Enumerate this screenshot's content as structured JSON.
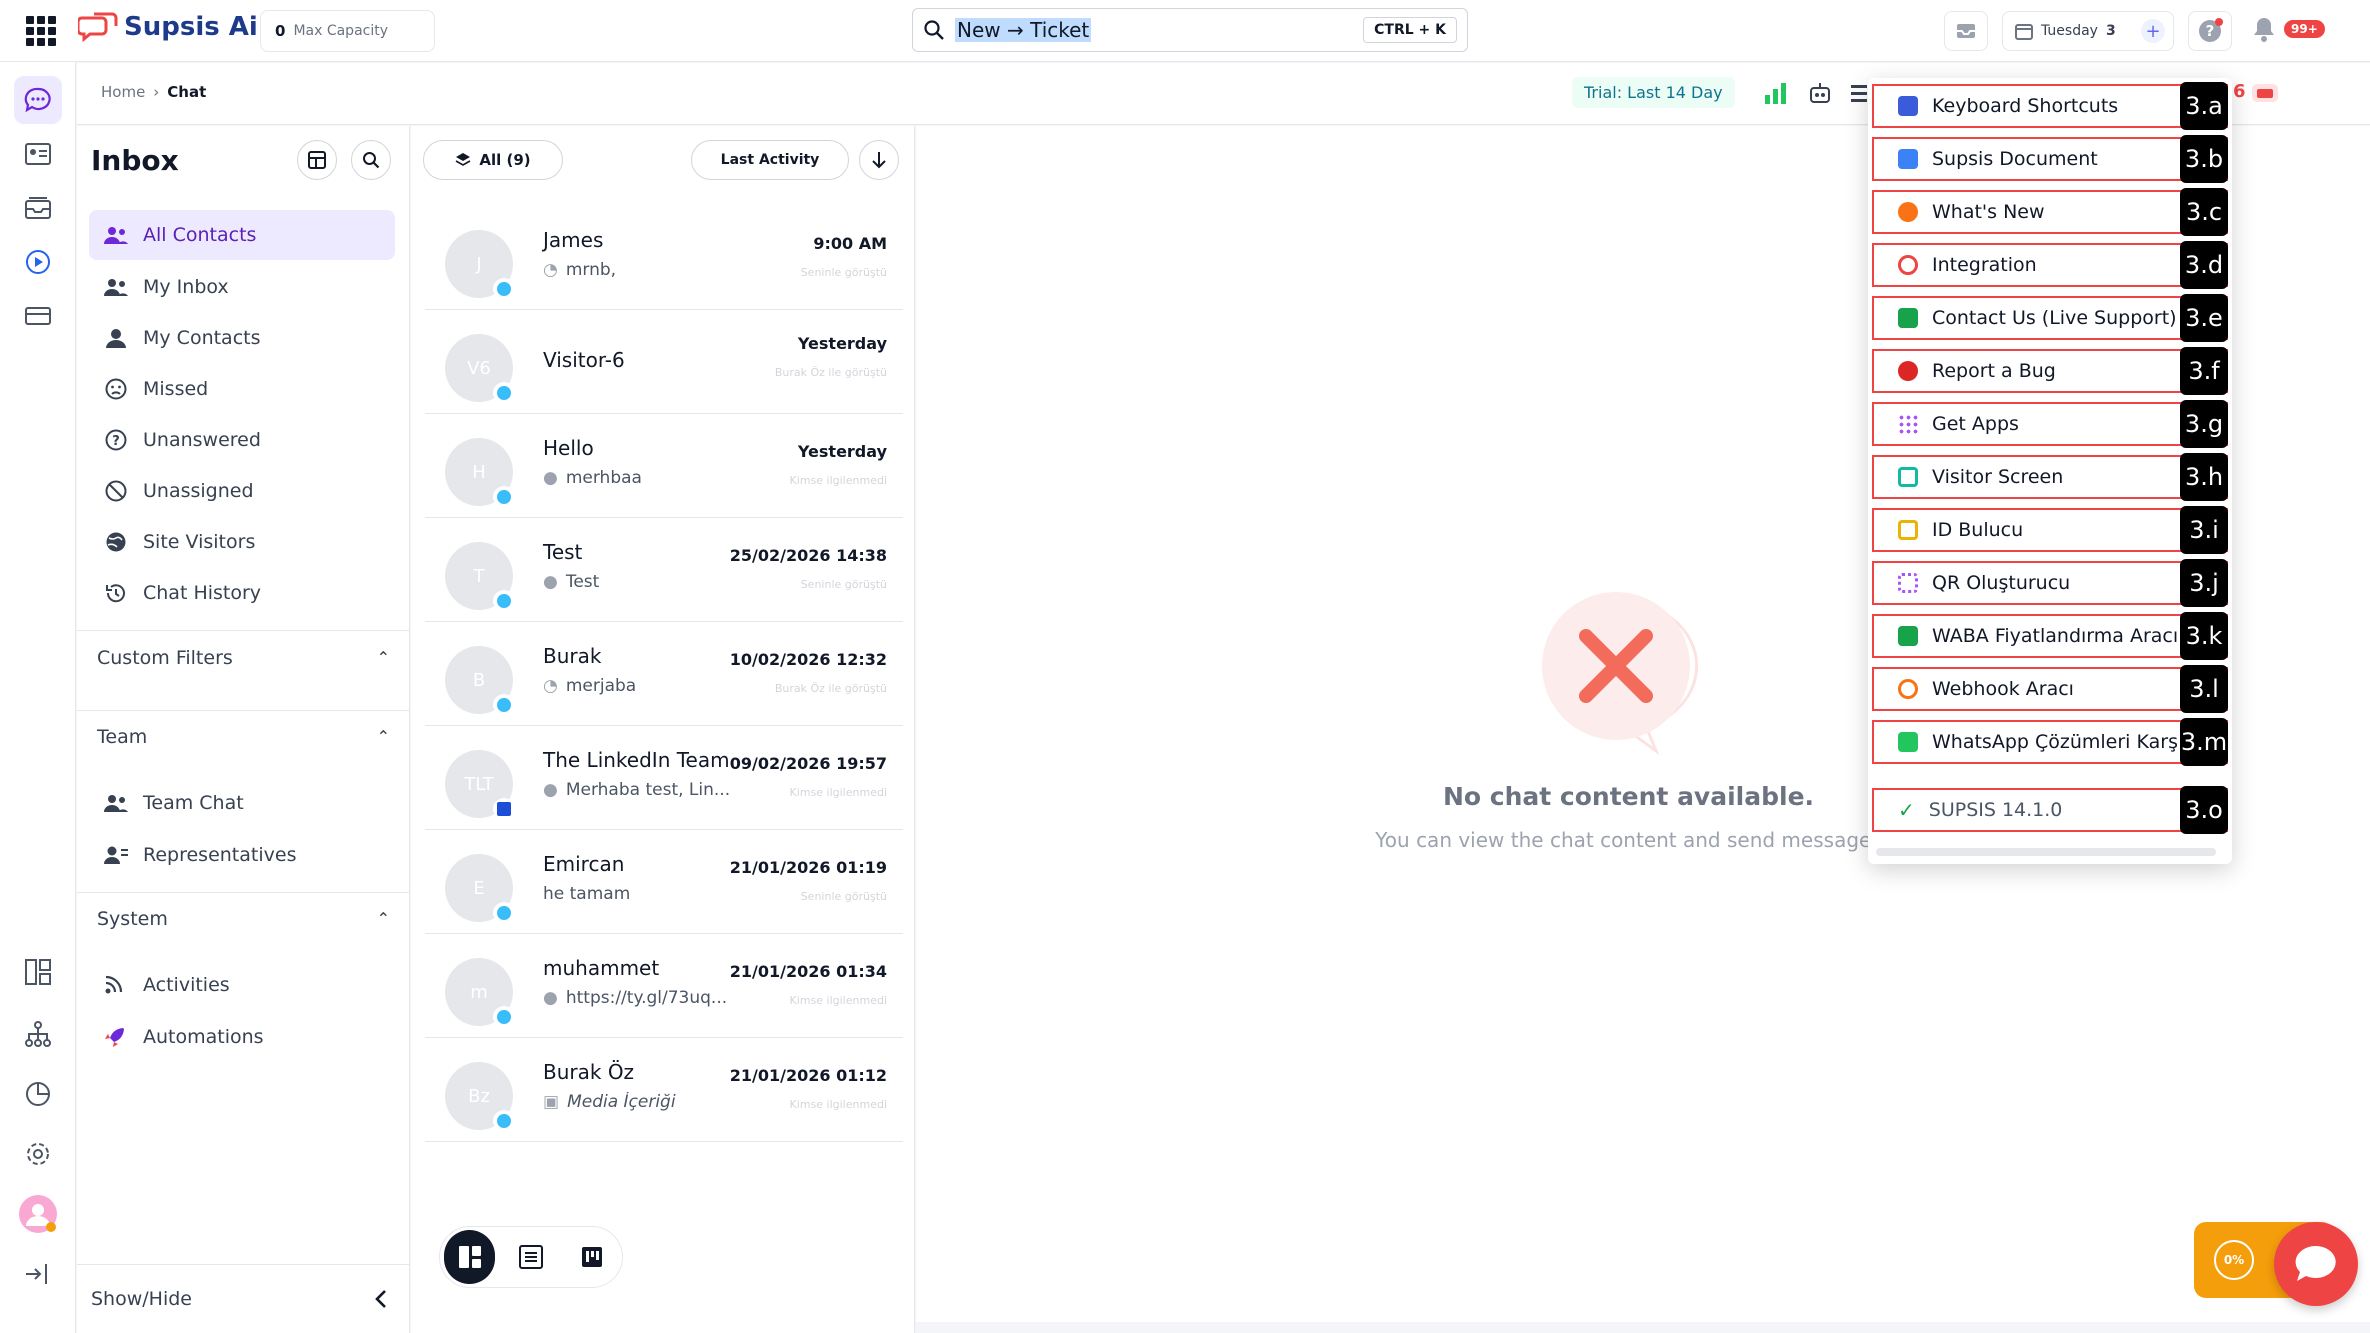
{
  "topbar": {
    "brand": "Supsis Ai",
    "capacity_value": "0",
    "capacity_label": "Max Capacity",
    "search_value": "New → Ticket",
    "search_shortcut": "CTRL + K",
    "date_label": "Tuesday",
    "date_value": "3",
    "notif_count": "99+"
  },
  "breadcrumb": {
    "home": "Home",
    "sep": "›",
    "current": "Chat",
    "trial": "Trial: Last 14 Day",
    "badge_partial": "6"
  },
  "inbox": {
    "title": "Inbox",
    "items": [
      {
        "label": "All Contacts",
        "icon": "users-icon"
      },
      {
        "label": "My Inbox",
        "icon": "users-icon"
      },
      {
        "label": "My Contacts",
        "icon": "user-icon"
      },
      {
        "label": "Missed",
        "icon": "sad-face-icon"
      },
      {
        "label": "Unanswered",
        "icon": "question-icon"
      },
      {
        "label": "Unassigned",
        "icon": "block-icon"
      },
      {
        "label": "Site Visitors",
        "icon": "globe-icon"
      },
      {
        "label": "Chat History",
        "icon": "history-icon"
      }
    ],
    "custom_filters": "Custom Filters",
    "team": "Team",
    "team_items": [
      "Team Chat",
      "Representatives"
    ],
    "system": "System",
    "system_items": [
      "Activities",
      "Automations"
    ],
    "show_hide": "Show/Hide"
  },
  "list": {
    "filter_all": "All (9)",
    "sort": "Last Activity",
    "conversations": [
      {
        "initials": "J",
        "name": "James",
        "time": "9:00 AM",
        "msg": "mrnb,",
        "sub": "Seninle görüştü"
      },
      {
        "initials": "V6",
        "name": "Visitor-6",
        "time": "Yesterday",
        "msg": "",
        "sub": "Burak Öz ile görüştü"
      },
      {
        "initials": "H",
        "name": "Hello",
        "time": "Yesterday",
        "msg": "merhbaa",
        "sub": "Kimse ilgilenmedi"
      },
      {
        "initials": "T",
        "name": "Test",
        "time": "25/02/2026 14:38",
        "msg": "Test",
        "sub": "Seninle görüştü"
      },
      {
        "initials": "B",
        "name": "Burak",
        "time": "10/02/2026 12:32",
        "msg": "merjaba",
        "sub": "Burak Öz ile görüştü"
      },
      {
        "initials": "TLT",
        "name": "The LinkedIn Team",
        "time": "09/02/2026 19:57",
        "msg": "Merhaba test, Lin...",
        "sub": "Kimse ilgilenmedi"
      },
      {
        "initials": "E",
        "name": "Emircan",
        "time": "21/01/2026 01:19",
        "msg": "he tamam",
        "sub": "Seninle görüştü"
      },
      {
        "initials": "m",
        "name": "muhammet",
        "time": "21/01/2026 01:34",
        "msg": "https://ty.gl/73uq...",
        "sub": "Kimse ilgilenmedi"
      },
      {
        "initials": "Bz",
        "name": "Burak Öz",
        "time": "21/01/2026 01:12",
        "msg": "Media İçeriği",
        "sub": "Kimse ilgilenmedi"
      }
    ]
  },
  "main": {
    "empty_title": "No chat content available.",
    "empty_sub": "You can view the chat content and send messages"
  },
  "menu": {
    "items": [
      {
        "label": "Keyboard Shortcuts",
        "tag": "3.a",
        "color": "#3b5bdb"
      },
      {
        "label": "Supsis Document",
        "tag": "3.b",
        "color": "#3b82f6"
      },
      {
        "label": "What's New",
        "tag": "3.c",
        "color": "#f97316"
      },
      {
        "label": "Integration",
        "tag": "3.d",
        "color": "#ef4444"
      },
      {
        "label": "Contact Us (Live Support)",
        "tag": "3.e",
        "color": "#16a34a"
      },
      {
        "label": "Report a Bug",
        "tag": "3.f",
        "color": "#dc2626"
      },
      {
        "label": "Get Apps",
        "tag": "3.g",
        "color": "#a855f7"
      },
      {
        "label": "Visitor Screen",
        "tag": "3.h",
        "color": "#14b8a6"
      },
      {
        "label": "ID Bulucu",
        "tag": "3.i",
        "color": "#eab308"
      },
      {
        "label": "QR Oluşturucu",
        "tag": "3.j",
        "color": "#a855f7"
      },
      {
        "label": "WABA Fiyatlandırma Aracı",
        "tag": "3.k",
        "color": "#16a34a"
      },
      {
        "label": "Webhook Aracı",
        "tag": "3.l",
        "color": "#f97316"
      },
      {
        "label": "WhatsApp Çözümleri Karşıl",
        "tag": "3.m",
        "color": "#22c55e"
      }
    ],
    "version": "SUPSIS 14.1.0",
    "version_tag": "3.o"
  },
  "widget": {
    "progress": "0%"
  },
  "colors": {
    "accent": "#6d28d9",
    "brand": "#1e3a8a",
    "danger": "#ef4444"
  }
}
